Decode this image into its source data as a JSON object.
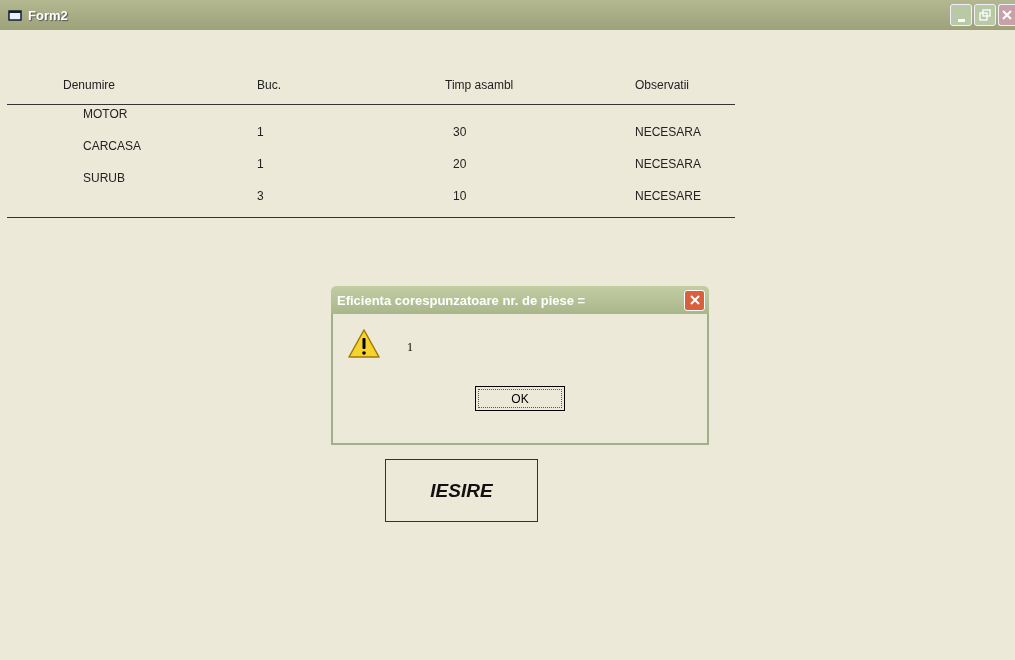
{
  "window": {
    "title": "Form2"
  },
  "table": {
    "columns": [
      "Denumire",
      "Buc.",
      "Timp asambl",
      "Observatii"
    ],
    "rows": [
      {
        "name": "MOTOR",
        "buc": "1",
        "timp": "30",
        "obs": "NECESARA"
      },
      {
        "name": "CARCASA",
        "buc": "1",
        "timp": "20",
        "obs": "NECESARA"
      },
      {
        "name": "SURUB",
        "buc": "3",
        "timp": "10",
        "obs": "NECESARE"
      }
    ]
  },
  "dialog": {
    "title": "Eficienta corespunzatoare nr. de piese =",
    "message": "1",
    "button": "OK"
  },
  "exit_button": "IESIRE"
}
